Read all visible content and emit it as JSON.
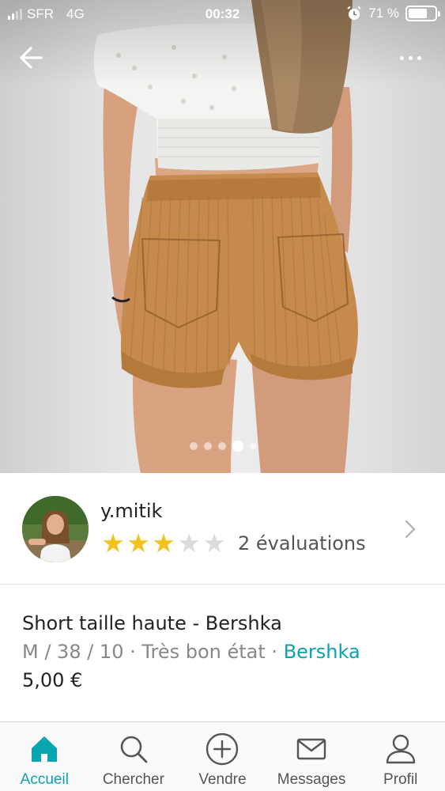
{
  "status_bar": {
    "carrier": "SFR",
    "network": "4G",
    "time": "00:32",
    "battery": "71 %",
    "battery_level": 0.71
  },
  "gallery": {
    "photo_count": 5,
    "active_index": 3
  },
  "seller": {
    "username": "y.mitik",
    "rating_stars": 3,
    "rating_max": 5,
    "reviews_label": "2 évaluations"
  },
  "item": {
    "title": "Short taille haute - Bershka",
    "size": "M / 38 / 10",
    "separator": " · ",
    "condition": "Très bon état",
    "brand": "Bershka",
    "price": "5,00 €"
  },
  "tab_bar": {
    "home": "Accueil",
    "search": "Chercher",
    "sell": "Vendre",
    "messages": "Messages",
    "profile": "Profil"
  },
  "colors": {
    "accent": "#09a4ad",
    "star": "#f5c21b",
    "star_empty": "#dcdcdc"
  }
}
